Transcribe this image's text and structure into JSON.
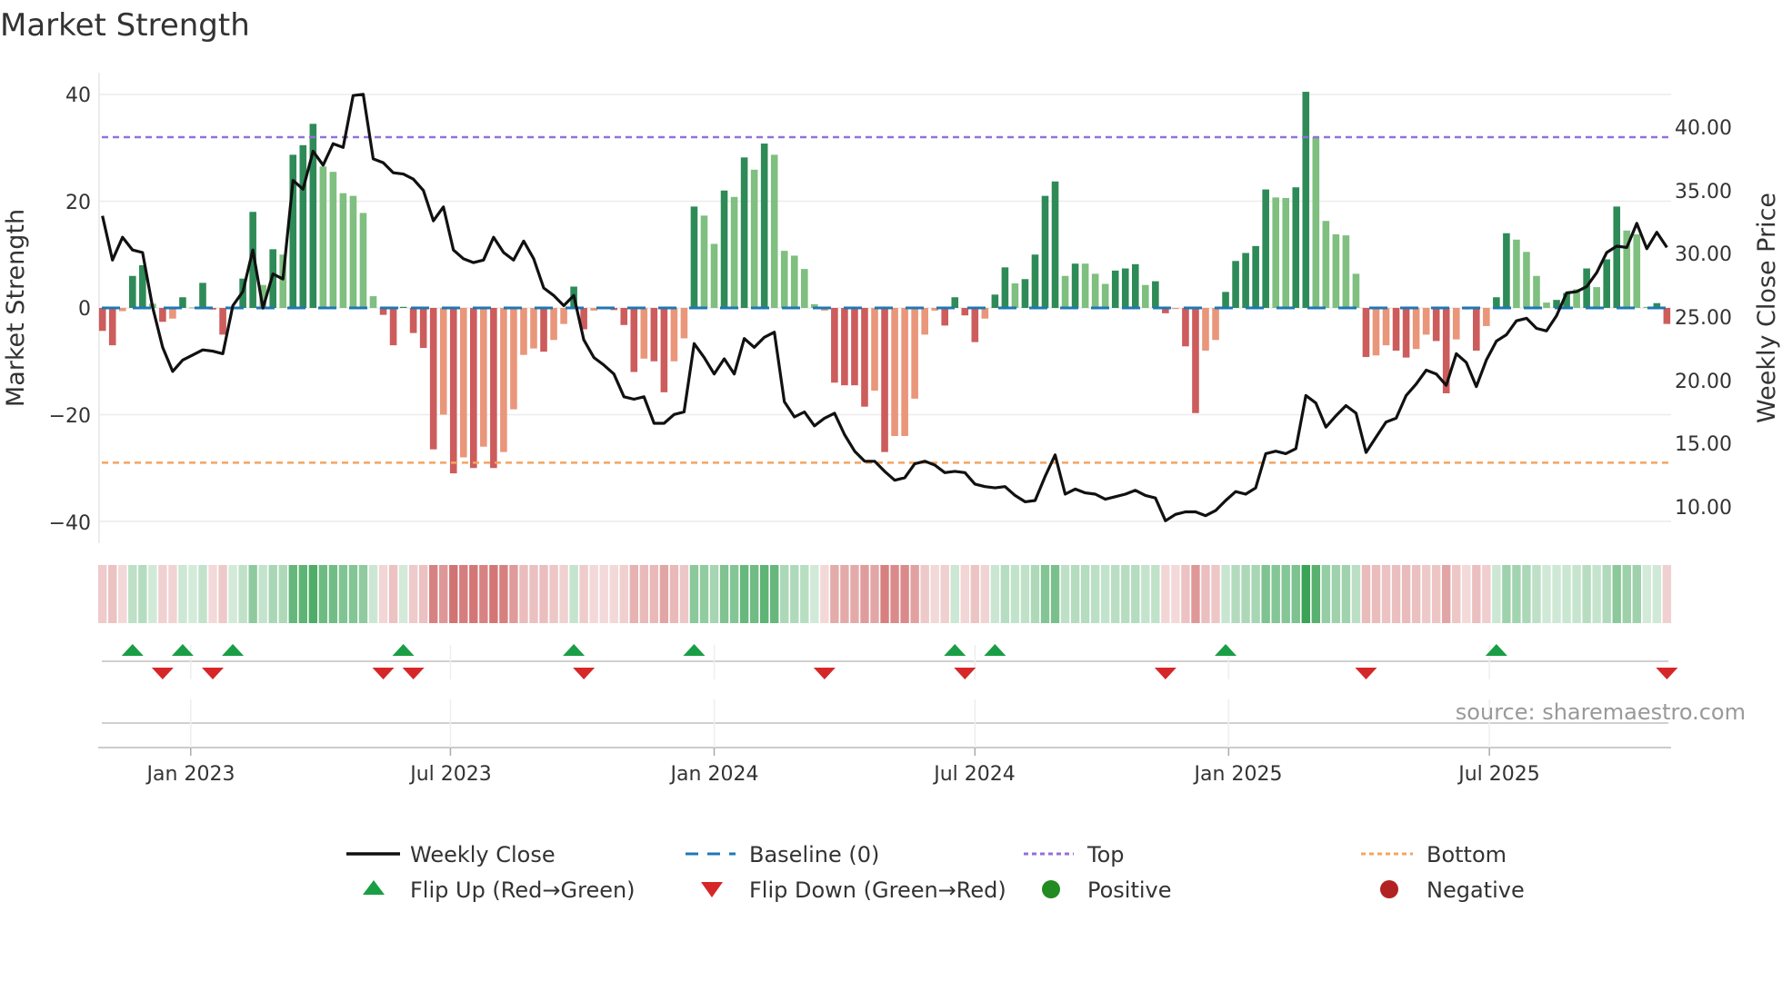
{
  "chart_data": {
    "type": "bar",
    "title": "Market Strength",
    "ylabel": "Market Strength",
    "y2label": "Weekly Close Price",
    "ylim": [
      -44,
      44
    ],
    "y2lim": [
      8,
      43
    ],
    "yticks": [
      "40",
      "20",
      "0",
      "−20",
      "−40"
    ],
    "ytick_values": [
      40,
      20,
      0,
      -20,
      -40
    ],
    "y2ticks": [
      "40.00",
      "35.00",
      "30.00",
      "25.00",
      "20.00",
      "15.00",
      "10.00"
    ],
    "y2tick_values": [
      40,
      35,
      30,
      25,
      20,
      15,
      10
    ],
    "xticks": [
      {
        "label": "Jan 2023",
        "week": 8.8
      },
      {
        "label": "Jul 2023",
        "week": 34.7
      },
      {
        "label": "Jan 2024",
        "week": 61.0
      },
      {
        "label": "Jul 2024",
        "week": 87.0
      },
      {
        "label": "Jan 2025",
        "week": 112.3
      },
      {
        "label": "Jul 2025",
        "week": 138.3
      }
    ],
    "top_level": 32,
    "bottom_level": -29,
    "baseline": 0,
    "strength": [
      -4.3,
      -7,
      -0.6,
      6,
      8,
      0.8,
      -2.6,
      -2,
      2,
      0.1,
      4.7,
      -0.3,
      -5,
      0.2,
      5.5,
      18,
      4.3,
      11,
      10,
      28.7,
      30.5,
      34.5,
      26.5,
      25.5,
      21.5,
      21,
      17.8,
      2.2,
      -1.3,
      -7,
      0.2,
      -4.7,
      -7.5,
      -26.5,
      -20,
      -31,
      -28,
      -30,
      -26,
      -30,
      -27,
      -19,
      -8.8,
      -7.6,
      -8.2,
      -6,
      -3,
      4,
      -4,
      -0.5,
      -0.2,
      -0.4,
      -3.2,
      -12,
      -9.5,
      -10,
      -15.8,
      -10,
      -5.7,
      19,
      17.3,
      12,
      22,
      20.8,
      28.2,
      25.9,
      30.8,
      28.7,
      10.7,
      9.8,
      7.3,
      0.7,
      -0.5,
      -14,
      -14.5,
      -14.5,
      -18.5,
      -15.5,
      -27,
      -24,
      -24,
      -17,
      -5,
      -0.5,
      -3.3,
      2,
      -1.4,
      -6.4,
      -2,
      2.5,
      7.6,
      4.6,
      5.4,
      10,
      21,
      23.7,
      6,
      8.3,
      8.3,
      6.4,
      4.5,
      7,
      7.4,
      8.2,
      4.3,
      5,
      -1,
      -0.2,
      -7.2,
      -19.7,
      -8,
      -6,
      3,
      8.8,
      10.3,
      11.6,
      22.2,
      20.7,
      20.6,
      22.6,
      40.5,
      32,
      16.3,
      13.8,
      13.6,
      6.4,
      -9.2,
      -8.9,
      -7,
      -8,
      -9.3,
      -7.7,
      -5,
      -6.2,
      -16,
      -5.9,
      -0.3,
      -8,
      -3.4,
      2,
      14,
      12.8,
      10.5,
      6,
      1,
      1.5,
      2.8,
      3.5,
      7.4,
      3.9,
      9.1,
      19,
      14.5,
      13.8,
      0.2,
      0.9,
      -3
    ],
    "strength_rising": [
      1,
      1,
      0,
      1,
      1,
      0,
      1,
      0,
      1,
      0,
      1,
      1,
      1,
      0,
      1,
      1,
      0,
      1,
      0,
      1,
      1,
      1,
      0,
      0,
      0,
      0,
      0,
      0,
      1,
      1,
      1,
      1,
      1,
      1,
      0,
      1,
      0,
      1,
      0,
      1,
      0,
      0,
      0,
      0,
      1,
      0,
      0,
      1,
      1,
      0,
      0,
      1,
      1,
      1,
      0,
      1,
      1,
      0,
      0,
      1,
      0,
      0,
      1,
      0,
      1,
      0,
      1,
      0,
      0,
      0,
      0,
      0,
      0,
      1,
      1,
      1,
      1,
      0,
      1,
      0,
      0,
      0,
      0,
      0,
      1,
      1,
      1,
      1,
      0,
      1,
      1,
      0,
      1,
      1,
      1,
      1,
      0,
      1,
      0,
      0,
      0,
      1,
      1,
      1,
      0,
      1,
      1,
      0,
      1,
      1,
      0,
      0,
      1,
      1,
      1,
      1,
      1,
      0,
      0,
      1,
      1,
      0,
      0,
      0,
      0,
      0,
      1,
      0,
      0,
      1,
      1,
      0,
      0,
      1,
      1,
      0,
      0,
      1,
      0,
      1,
      1,
      0,
      0,
      0,
      0,
      1,
      1,
      0,
      1,
      0,
      1,
      1,
      0,
      0,
      0,
      1,
      1
    ],
    "weekly_close": [
      33.0,
      29.5,
      31.3,
      30.3,
      30.1,
      25.8,
      22.6,
      20.7,
      21.6,
      22.0,
      22.4,
      22.3,
      22.1,
      25.9,
      27.0,
      30.3,
      25.7,
      28.4,
      28.0,
      35.8,
      35.1,
      38.1,
      37.0,
      38.7,
      38.4,
      42.5,
      42.6,
      37.5,
      37.2,
      36.4,
      36.3,
      35.9,
      35.0,
      32.6,
      33.7,
      30.3,
      29.6,
      29.3,
      29.5,
      31.3,
      30.1,
      29.5,
      31.0,
      29.6,
      27.3,
      26.7,
      25.9,
      26.7,
      23.2,
      21.8,
      21.2,
      20.5,
      18.7,
      18.5,
      18.7,
      16.6,
      16.6,
      17.3,
      17.5,
      22.9,
      21.8,
      20.5,
      21.7,
      20.5,
      23.3,
      22.6,
      23.4,
      23.8,
      18.3,
      17.1,
      17.5,
      16.4,
      17.0,
      17.4,
      15.7,
      14.4,
      13.6,
      13.6,
      12.8,
      12.1,
      12.3,
      13.4,
      13.6,
      13.3,
      12.7,
      12.8,
      12.7,
      11.8,
      11.6,
      11.5,
      11.6,
      10.9,
      10.4,
      10.5,
      12.4,
      14.1,
      11.0,
      11.4,
      11.1,
      11.0,
      10.6,
      10.8,
      11.0,
      11.3,
      10.9,
      10.7,
      8.9,
      9.4,
      9.6,
      9.6,
      9.3,
      9.7,
      10.5,
      11.2,
      11.0,
      11.5,
      14.2,
      14.4,
      14.2,
      14.6,
      18.8,
      18.2,
      16.3,
      17.2,
      18.0,
      17.4,
      14.3,
      15.5,
      16.7,
      17.0,
      18.8,
      19.7,
      20.8,
      20.5,
      19.6,
      22.1,
      21.4,
      19.5,
      21.6,
      23.1,
      23.6,
      24.7,
      24.9,
      24.1,
      23.9,
      25.1,
      26.9,
      27.0,
      27.4,
      28.5,
      30.1,
      30.6,
      30.5,
      32.4,
      30.4,
      31.7,
      30.5
    ],
    "flip_up_weeks": [
      3,
      8,
      13,
      30,
      47,
      59,
      85,
      89,
      112,
      139
    ],
    "flip_down_weeks": [
      6,
      11,
      28,
      31,
      48,
      72,
      86,
      106,
      126,
      156
    ],
    "legend": {
      "placement": "bottom",
      "items": [
        {
          "key": "close",
          "label": "Weekly Close"
        },
        {
          "key": "baseline",
          "label": "Baseline (0)"
        },
        {
          "key": "top",
          "label": "Top"
        },
        {
          "key": "bottom",
          "label": "Bottom"
        },
        {
          "key": "flip_up",
          "label": "Flip Up (Red→Green)"
        },
        {
          "key": "flip_down",
          "label": "Flip Down (Green→Red)"
        },
        {
          "key": "positive",
          "label": "Positive"
        },
        {
          "key": "negative",
          "label": "Negative"
        }
      ]
    },
    "colors": {
      "pos_strong": "#2e8b57",
      "pos_weak": "#7fbf7f",
      "neg_strong": "#cd5c5c",
      "neg_weak": "#e9967a",
      "close": "#111111",
      "baseline": "#1f77b4",
      "top": "#9370db",
      "bottom": "#f4a460",
      "flip_up": "#1a9e45",
      "flip_down": "#d62728",
      "positive": "#228b22",
      "negative": "#b22222",
      "strip_pos": "#3aa356",
      "strip_neg": "#c95555"
    },
    "grid": true
  },
  "source": "source: sharemaestro.com"
}
